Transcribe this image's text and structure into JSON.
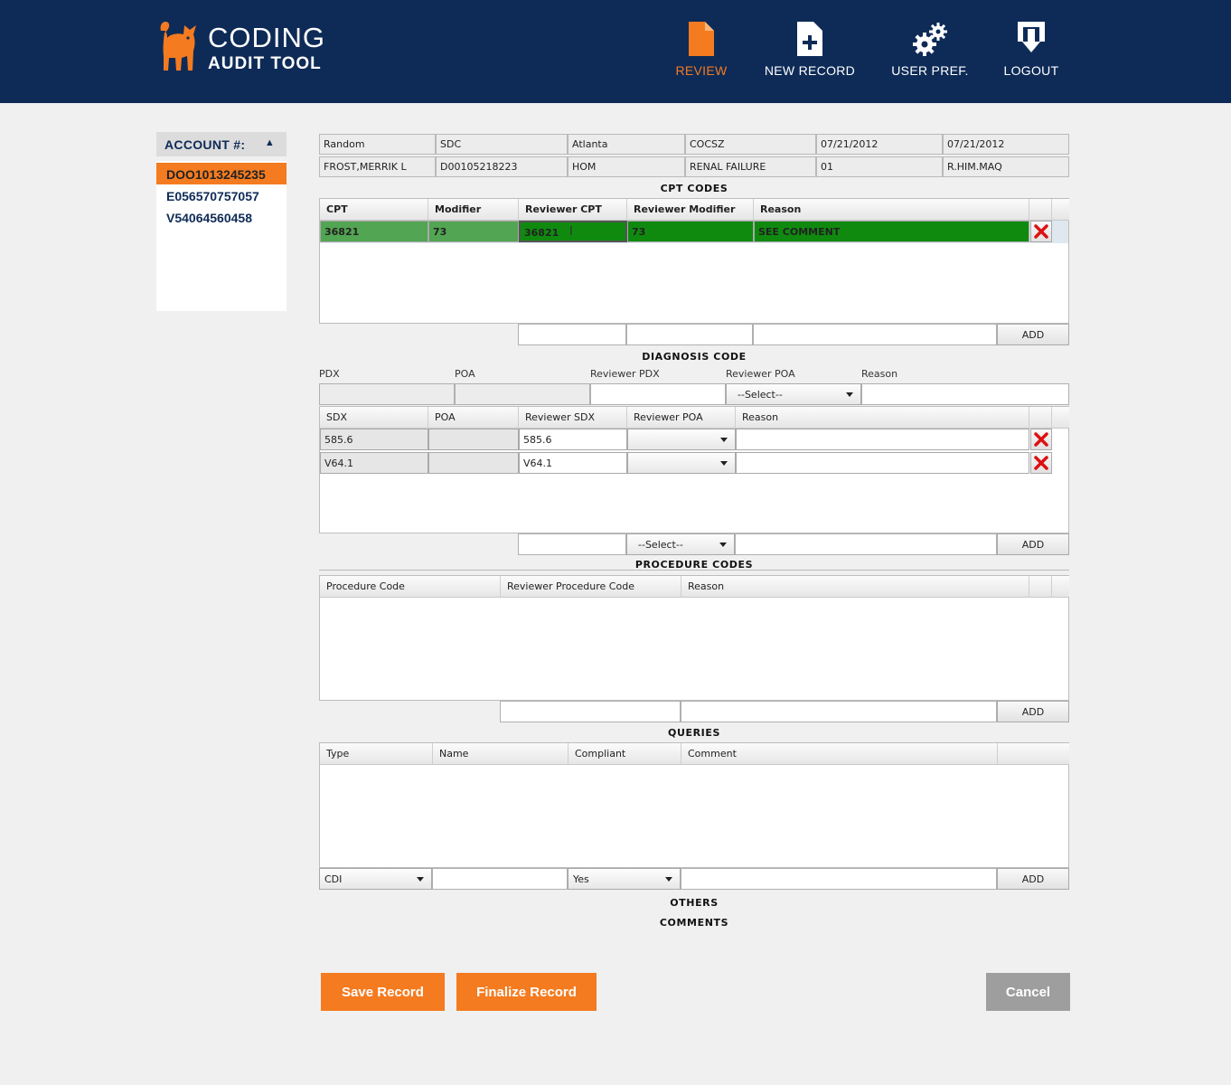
{
  "app": {
    "logo_line1": "CODING",
    "logo_line2": "AUDIT TOOL",
    "accent_color": "#f47b20",
    "header_color": "#0e2b57"
  },
  "nav": [
    {
      "label": "REVIEW",
      "icon": "document-icon",
      "active": true
    },
    {
      "label": "NEW RECORD",
      "icon": "new-document-icon",
      "active": false
    },
    {
      "label": "USER PREF.",
      "icon": "gears-icon",
      "active": false
    },
    {
      "label": "LOGOUT",
      "icon": "logout-icon",
      "active": false
    }
  ],
  "accounts": {
    "header": "ACCOUNT #:",
    "items": [
      "DOO1013245235",
      "E056570757057",
      "V54064560458"
    ],
    "selected": "DOO1013245235"
  },
  "info": {
    "row1": [
      "Random",
      "SDC",
      "Atlanta",
      "COCSZ",
      "07/21/2012",
      "07/21/2012"
    ],
    "row2": [
      "FROST,MERRIK L",
      "D00105218223",
      "HOM",
      "RENAL FAILURE",
      "01",
      "R.HIM.MAQ"
    ]
  },
  "cpt": {
    "title": "CPT CODES",
    "columns": [
      "CPT",
      "Modifier",
      "Reviewer CPT",
      "Reviewer Modifier",
      "Reason"
    ],
    "rows": [
      {
        "cpt": "36821",
        "modifier": "73",
        "reviewer_cpt": "36821",
        "reviewer_modifier": "73",
        "reason": "SEE COMMENT"
      }
    ],
    "add_label": "ADD"
  },
  "diagnosis": {
    "title": "DIAGNOSIS CODE",
    "labels": [
      "PDX",
      "POA",
      "Reviewer PDX",
      "Reviewer POA",
      "Reason"
    ],
    "poa_select": "--Select--",
    "columns": [
      "SDX",
      "POA",
      "Reviewer SDX",
      "Reviewer POA",
      "Reason"
    ],
    "rows": [
      {
        "sdx": "585.6",
        "poa": "",
        "reviewer_sdx": "585.6",
        "reviewer_poa": "",
        "reason": ""
      },
      {
        "sdx": "V64.1",
        "poa": "",
        "reviewer_sdx": "V64.1",
        "reviewer_poa": "",
        "reason": ""
      }
    ],
    "add_select": "--Select--",
    "add_label": "ADD"
  },
  "procedure": {
    "title": "PROCEDURE CODES",
    "columns": [
      "Procedure Code",
      "Reviewer Procedure Code",
      "Reason"
    ],
    "add_label": "ADD"
  },
  "queries": {
    "title": "QUERIES",
    "columns": [
      "Type",
      "Name",
      "Compliant",
      "Comment"
    ],
    "type_select": "CDI",
    "compliant_select": "Yes",
    "add_label": "ADD"
  },
  "others_title": "OTHERS",
  "comments_title": "COMMENTS",
  "buttons": {
    "save": "Save Record",
    "finalize": "Finalize Record",
    "cancel": "Cancel"
  },
  "colors": {
    "row_green": "#0f8a0f",
    "row_green_light": "#52a552",
    "cancel_gray": "#9e9e9e"
  }
}
